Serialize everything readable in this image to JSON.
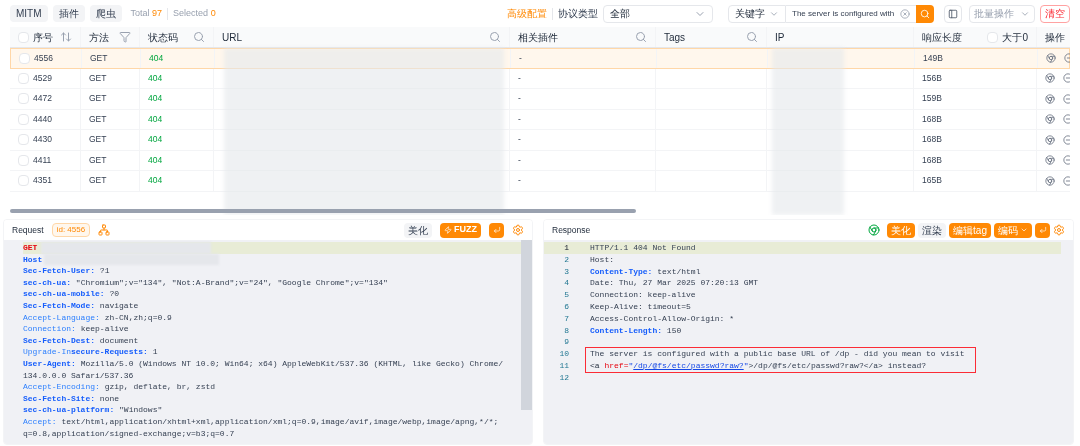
{
  "toolbar": {
    "tabs": [
      {
        "label": "MITM"
      },
      {
        "label": "插件"
      },
      {
        "label": "爬虫"
      }
    ],
    "total_label": "Total",
    "total": "97",
    "selected_label": "Selected",
    "selected": "0",
    "advanced": "高级配置",
    "protocol_label": "协议类型",
    "protocol": "全部",
    "search_type": "关键字",
    "search_value": "The server is configured with",
    "batch": "批量操作",
    "clear": "清空"
  },
  "table": {
    "select_all": {
      "checked": false
    },
    "columns": [
      {
        "label": "序号",
        "kind": "sort"
      },
      {
        "label": "方法",
        "kind": "filter"
      },
      {
        "label": "状态码",
        "kind": "search"
      },
      {
        "label": "URL",
        "kind": "search"
      },
      {
        "label": "相关插件",
        "kind": "search"
      },
      {
        "label": "Tags",
        "kind": "search"
      },
      {
        "label": "IP",
        "kind": "plain"
      },
      {
        "label": "响应长度",
        "kind": "plain"
      },
      {
        "label": "操作",
        "kind": "plain"
      }
    ],
    "size_filter": {
      "label": "大于0",
      "checked": false
    },
    "rows": [
      {
        "id": "4556",
        "method": "GET",
        "status": "404",
        "plugins": "-",
        "length": "149B",
        "selected": true,
        "checked": false
      },
      {
        "id": "4529",
        "method": "GET",
        "status": "404",
        "plugins": "-",
        "length": "156B",
        "selected": false,
        "checked": false
      },
      {
        "id": "4472",
        "method": "GET",
        "status": "404",
        "plugins": "-",
        "length": "159B",
        "selected": false,
        "checked": false
      },
      {
        "id": "4440",
        "method": "GET",
        "status": "404",
        "plugins": "-",
        "length": "168B",
        "selected": false,
        "checked": false
      },
      {
        "id": "4430",
        "method": "GET",
        "status": "404",
        "plugins": "-",
        "length": "168B",
        "selected": false,
        "checked": false
      },
      {
        "id": "4411",
        "method": "GET",
        "status": "404",
        "plugins": "-",
        "length": "168B",
        "selected": false,
        "checked": false
      },
      {
        "id": "4351",
        "method": "GET",
        "status": "404",
        "plugins": "-",
        "length": "165B",
        "selected": false,
        "checked": false
      }
    ]
  },
  "request": {
    "title": "Request",
    "id_badge": "id: 4556",
    "beautify": "美化",
    "fuzz": "FUZZ",
    "lines": [
      {
        "kind": "method",
        "key": "GET"
      },
      {
        "kind": "host",
        "key": "Host"
      },
      {
        "kind": "bold",
        "key": "Sec-Fetch-User:",
        "value": "?1"
      },
      {
        "kind": "bold",
        "key": "sec-ch-ua:",
        "value": "\"Chromium\";v=\"134\", \"Not:A-Brand\";v=\"24\", \"Google Chrome\";v=\"134\""
      },
      {
        "kind": "bold",
        "key": "sec-ch-ua-mobile:",
        "value": "?0"
      },
      {
        "kind": "bold",
        "key": "Sec-Fetch-Mode:",
        "value": "navigate"
      },
      {
        "kind": "plain",
        "key": "Accept-Language:",
        "value": "zh-CN,zh;q=0.9"
      },
      {
        "kind": "plain",
        "key": "Connection:",
        "value": "keep-alive"
      },
      {
        "kind": "bold",
        "key": "Sec-Fetch-Dest:",
        "value": "document"
      },
      {
        "kind": "mixed",
        "key": "Upgrade-In",
        "key2": "secure-Requests:",
        "value": "1"
      },
      {
        "kind": "bold",
        "key": "User-Agent:",
        "value": "Mozilla/5.0 (Windows NT 10.0; Win64; x64) AppleWebKit/537.36 (KHTML, like Gecko) Chrome/"
      },
      {
        "kind": "cont",
        "value": "134.0.0.0 Safari/537.36"
      },
      {
        "kind": "plain",
        "key": "Accept-Encoding:",
        "value": "gzip, deflate, br, zstd"
      },
      {
        "kind": "bold",
        "key": "Sec-Fetch-Site:",
        "value": "none"
      },
      {
        "kind": "bold",
        "key": "sec-ch-ua-platform:",
        "value": "\"Windows\""
      },
      {
        "kind": "plain",
        "key": "Accept:",
        "value": "text/html,application/xhtml+xml,application/xml;q=0.9,image/avif,image/webp,image/apng,*/*;"
      },
      {
        "kind": "cont",
        "value": "q=0.8,application/signed-exchange;v=b3;q=0.7"
      }
    ]
  },
  "response": {
    "title": "Response",
    "beautify": "美化",
    "render": "渲染",
    "edit_tag": "编辑tag",
    "encoding": "编码",
    "lines": [
      {
        "no": "1",
        "kind": "text",
        "text": "HTTP/1.1 404 Not Found",
        "current": true
      },
      {
        "no": "2",
        "kind": "text",
        "text": "Host:",
        "current": false
      },
      {
        "no": "3",
        "kind": "header",
        "key": "Content-Type:",
        "value": "text/html",
        "current": false
      },
      {
        "no": "4",
        "kind": "text",
        "text": "Date: Thu, 27 Mar 2025 07:20:13 GMT",
        "current": false
      },
      {
        "no": "5",
        "kind": "text",
        "text": "Connection: keep-alive",
        "current": false
      },
      {
        "no": "6",
        "kind": "text",
        "text": "Keep-Alive: timeout=5",
        "current": false
      },
      {
        "no": "7",
        "kind": "text",
        "text": "Access-Control-Allow-Origin: *",
        "current": false
      },
      {
        "no": "8",
        "kind": "header",
        "key": "Content-Length:",
        "value": "150",
        "current": false
      },
      {
        "no": "9",
        "kind": "text",
        "current": false
      },
      {
        "no": "10",
        "kind": "text",
        "text": "The server is configured with a public base URL of /dp - did you mean to visit",
        "current": false,
        "boxed": true
      },
      {
        "no": "11",
        "kind": "html",
        "tag": "<a",
        "attr": "href=",
        "quote_open": "\"",
        "link": "/dp/@fs/etc/passwd?raw?",
        "quote_close": "\"",
        "rest": ">/dp/@fs/etc/passwd?raw?</a>",
        "tail": "instead?",
        "current": false,
        "boxed": true
      },
      {
        "no": "12",
        "kind": "text",
        "current": false
      }
    ]
  }
}
